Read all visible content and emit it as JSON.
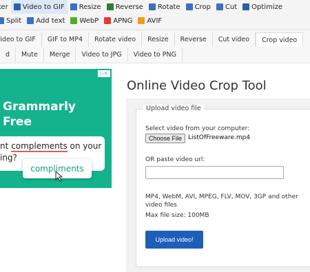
{
  "toolbar": {
    "row1": [
      {
        "label": "ker",
        "icon": "",
        "color": ""
      },
      {
        "label": "Video to GIF",
        "icon": "film-icon",
        "color": "#2b5fa8",
        "active": true
      },
      {
        "label": "Resize",
        "icon": "resize-icon",
        "color": "#3a6fc4"
      },
      {
        "label": "Reverse",
        "icon": "reverse-icon",
        "color": "#2e7d32"
      },
      {
        "label": "Rotate",
        "icon": "rotate-icon",
        "color": "#3a6fc4"
      },
      {
        "label": "Crop",
        "icon": "crop-icon",
        "color": "#3a6fc4"
      },
      {
        "label": "Cut",
        "icon": "cut-icon",
        "color": "#3a6fc4"
      },
      {
        "label": "Optimize",
        "icon": "optimize-icon",
        "color": "#2b5fa8"
      }
    ],
    "row2": [
      {
        "label": "Split",
        "icon": "split-icon",
        "color": "#3a6fc4"
      },
      {
        "label": "Add text",
        "icon": "text-icon",
        "color": "#3a6fc4"
      },
      {
        "label": "WebP",
        "icon": "webp-icon",
        "color": "#4caf2a"
      },
      {
        "label": "APNG",
        "icon": "apng-icon",
        "color": "#e53935"
      },
      {
        "label": "AVIF",
        "icon": "avif-icon",
        "color": "#f39c12"
      }
    ]
  },
  "tabs": {
    "row1": [
      "Video to GIF",
      "GIF to MP4",
      "Rotate video",
      "Resize",
      "Reverse",
      "Cut video",
      "Crop video"
    ],
    "row2": [
      "d",
      "Mute",
      "Merge",
      "Video to JPG",
      "Video to PNG"
    ],
    "active": "Crop video"
  },
  "ad": {
    "title": "Grammarly",
    "subtitle": "Free",
    "bubble_pre": "nt ",
    "bubble_highlight": "complements",
    "bubble_post": " on your",
    "bubble_line2": "ing?",
    "suggestion": "compliments",
    "choice_label": "▷✕",
    "bg_color": "#14b38d"
  },
  "main": {
    "title": "Online Video Crop Tool",
    "legend": "Upload video file",
    "select_label": "Select video from your computer:",
    "choose_label": "Choose File",
    "file_name": "ListOfFreeware.mp4",
    "url_label": "OR paste video url:",
    "url_value": "",
    "formats": "MP4, WebM, AVI, MPEG, FLV, MOV, 3GP and other video files",
    "max_size": "Max file size: 100MB",
    "upload_label": "Upload video!",
    "upload_color": "#1d5fb8"
  }
}
